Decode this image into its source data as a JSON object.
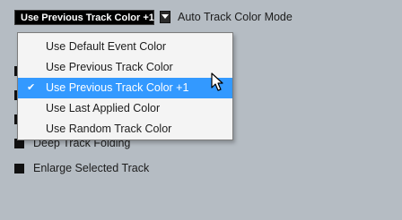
{
  "track_color_mode": {
    "selected_value": "Use Previous Track Color +1",
    "label": "Auto Track Color Mode"
  },
  "menu": {
    "items": [
      {
        "label": "Use Default Event Color",
        "checked": false
      },
      {
        "label": "Use Previous Track Color",
        "checked": false
      },
      {
        "label": "Use Previous Track Color +1",
        "checked": true
      },
      {
        "label": "Use Last Applied Color",
        "checked": false
      },
      {
        "label": "Use Random Track Color",
        "checked": false
      }
    ],
    "check_glyph": "✔"
  },
  "options": {
    "deep_track_folding": "Deep Track Folding",
    "enlarge_selected_track": "Enlarge Selected Track"
  },
  "colors": {
    "background": "#b5bcc3",
    "selection": "#3399ff",
    "menu_background": "#f4f4f4"
  },
  "icons": {
    "dropdown_arrow": "chevron-down-icon",
    "cursor": "mouse-pointer-icon"
  }
}
